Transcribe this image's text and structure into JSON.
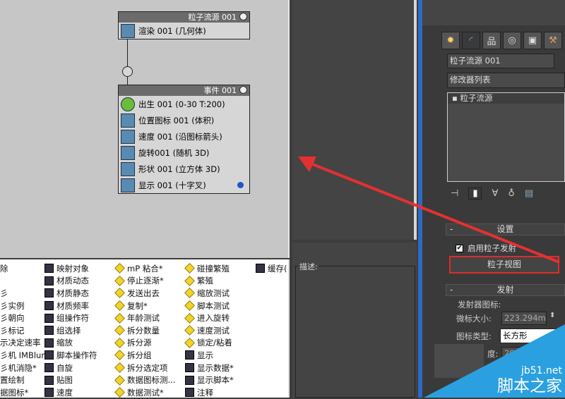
{
  "source_node": {
    "title": "粒子流源 001",
    "ops": [
      "渲染 001 (几何体)"
    ]
  },
  "event_node": {
    "title": "事件 001",
    "ops": [
      "出生 001 (0-30 T:200)",
      "位置图标 001 (体积)",
      "速度 001 (沿图标箭头)",
      "旋转001 (随机 3D)",
      "形状 001 (立方体 3D)",
      "显示 001 (十字叉)"
    ]
  },
  "depot": {
    "col1": [
      "除",
      "",
      "彡",
      "彡实例",
      "彡朝向",
      "彡标记",
      "示决定速率",
      "彡机 IMBlur*",
      "彡机消隐*",
      "置绘制",
      "据图标*"
    ],
    "col2": [
      "映射对象",
      "材质动态",
      "材质静态",
      "材质频率",
      "组操作符",
      "组选择",
      "缩放",
      "脚本操作符",
      "自旋",
      "贴图",
      "速度"
    ],
    "col3": [
      "mP 粘合*",
      "停止逐渐*",
      "发送出去",
      "复制*",
      "年龄测试",
      "拆分数量",
      "拆分源",
      "拆分组",
      "拆分选定项",
      "数据图标测...",
      "数据测试*"
    ],
    "col4": [
      "碰撞繁殖",
      "繁殖",
      "缩放测试",
      "脚本测试",
      "进入旋转",
      "速度测试",
      "锁定/粘着",
      "显示",
      "显示数据*",
      "显示脚本*",
      "注释"
    ],
    "col5": [
      "缓存("
    ]
  },
  "description": {
    "label": "描述:"
  },
  "command_panel": {
    "object_name": "粒子流源 001",
    "modifier_list": "修改器列表",
    "stack_item": "粒子流源",
    "settings": {
      "title": "设置",
      "enable_label": "启用粒子发射",
      "enabled": true,
      "particle_view_button": "粒子视图"
    },
    "emission": {
      "title": "发射",
      "group": "发射器图标:",
      "logo_size_label": "微标大小:",
      "logo_size_value": "223.294m",
      "icon_type_label": "图标类型:",
      "icon_type_value": "长方形",
      "length_label": "度:",
      "length_value": "291.007m"
    },
    "collapse": "-"
  },
  "watermark": {
    "line1": "jb51.net",
    "line2": "脚本之家"
  },
  "colors": {
    "accent_red": "#e02b2b",
    "blue_strip": "#2d6ac4"
  }
}
